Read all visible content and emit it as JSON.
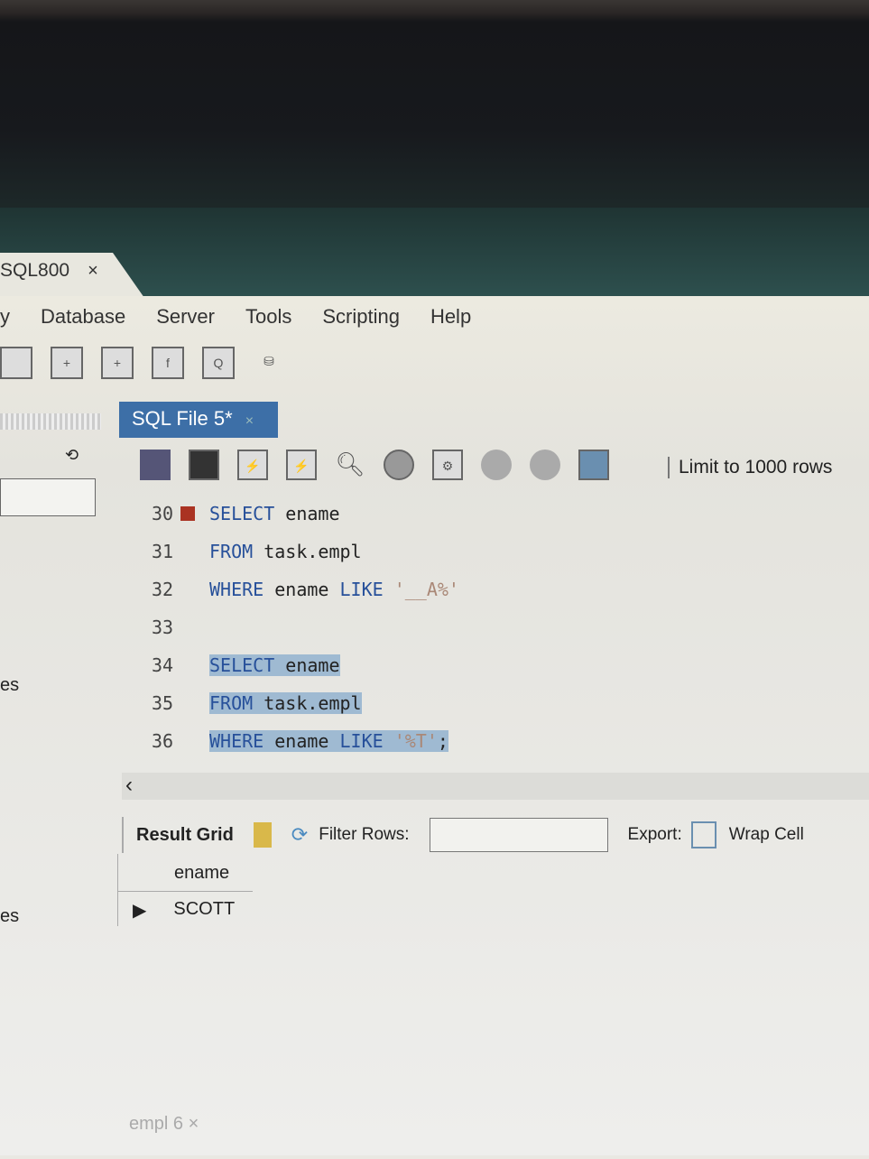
{
  "window_tab": {
    "title": "SQL800",
    "close": "×"
  },
  "menu": [
    "y",
    "Database",
    "Server",
    "Tools",
    "Scripting",
    "Help"
  ],
  "toolbar_icons": [
    "sql-new-icon",
    "sql-open-icon",
    "schema-icon",
    "function-icon",
    "inspector-icon",
    "reconnect-icon"
  ],
  "sidebar": {
    "labels": [
      "es",
      "es"
    ]
  },
  "file_tab": {
    "label": "SQL File 5*",
    "close": "×"
  },
  "editor_toolbar": {
    "limit": "Limit to 1000 rows"
  },
  "editor": {
    "lines": [
      {
        "num": "30",
        "error": true,
        "selected": false,
        "tokens": [
          {
            "t": "SELECT",
            "k": "kw"
          },
          {
            "t": " ename",
            "k": ""
          }
        ]
      },
      {
        "num": "31",
        "selected": false,
        "tokens": [
          {
            "t": "FROM",
            "k": "kw"
          },
          {
            "t": " task.empl",
            "k": ""
          }
        ]
      },
      {
        "num": "32",
        "selected": false,
        "tokens": [
          {
            "t": "WHERE",
            "k": "kw"
          },
          {
            "t": " ename ",
            "k": ""
          },
          {
            "t": "LIKE",
            "k": "kw"
          },
          {
            "t": " '__A%'",
            "k": "str"
          }
        ]
      },
      {
        "num": "33",
        "selected": false,
        "tokens": []
      },
      {
        "num": "34",
        "selected": true,
        "tokens": [
          {
            "t": "SELECT",
            "k": "kw"
          },
          {
            "t": " ename",
            "k": ""
          }
        ]
      },
      {
        "num": "35",
        "selected": true,
        "tokens": [
          {
            "t": "FROM",
            "k": "kw"
          },
          {
            "t": " task.empl",
            "k": ""
          }
        ]
      },
      {
        "num": "36",
        "selected": true,
        "tokens": [
          {
            "t": "WHERE",
            "k": "kw"
          },
          {
            "t": " ename ",
            "k": ""
          },
          {
            "t": "LIKE",
            "k": "kw"
          },
          {
            "t": " '%T'",
            "k": "str"
          },
          {
            "t": ";",
            "k": ""
          }
        ]
      }
    ]
  },
  "results": {
    "tab": "Result Grid",
    "filter_label": "Filter Rows:",
    "filter_value": "",
    "export_label": "Export:",
    "wrap_label": "Wrap Cell",
    "column": "ename",
    "rows": [
      "SCOTT"
    ]
  },
  "bottom_tab": {
    "label": "empl 6",
    "close": "×"
  }
}
